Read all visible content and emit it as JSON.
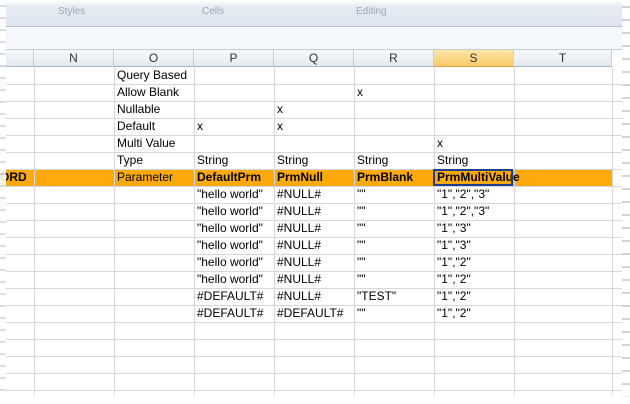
{
  "ribbon": {
    "group1": "Styles",
    "group2": "Cells",
    "group3": "Editing"
  },
  "columns": [
    "N",
    "O",
    "P",
    "Q",
    "R",
    "S",
    "T"
  ],
  "selected_column": "S",
  "rows": [
    [
      "",
      "Query Based",
      "",
      "",
      "",
      "",
      ""
    ],
    [
      "",
      "Allow Blank",
      "",
      "",
      "x",
      "",
      ""
    ],
    [
      "",
      "Nullable",
      "",
      "x",
      "",
      "",
      ""
    ],
    [
      "",
      "Default",
      "x",
      "x",
      "",
      "",
      ""
    ],
    [
      "",
      "Multi Value",
      "",
      "",
      "",
      "x",
      ""
    ],
    [
      "",
      "Type",
      "String",
      "String",
      "String",
      "String",
      ""
    ],
    [
      "",
      "Parameter",
      "DefaultPrm",
      "PrmNull",
      "PrmBlank",
      "PrmMultiValue",
      ""
    ],
    [
      "",
      "",
      "\"hello world\"",
      "#NULL#",
      "\"\"",
      "\"1\",\"2\",\"3\"",
      ""
    ],
    [
      "",
      "",
      "\"hello world\"",
      "#NULL#",
      "\"\"",
      "\"1\",\"2\",\"3\"",
      ""
    ],
    [
      "",
      "",
      "\"hello world\"",
      "#NULL#",
      "\"\"",
      "\"1\",\"3\"",
      ""
    ],
    [
      "",
      "",
      "\"hello world\"",
      "#NULL#",
      "\"\"",
      "\"1\",\"3\"",
      ""
    ],
    [
      "",
      "",
      "\"hello world\"",
      "#NULL#",
      "\"\"",
      "\"1\",\"2\"",
      ""
    ],
    [
      "",
      "",
      "\"hello world\"",
      "#NULL#",
      "\"\"",
      "\"1\",\"2\"",
      ""
    ],
    [
      "",
      "",
      "#DEFAULT#",
      "#NULL#",
      "\"TEST\"",
      "\"1\",\"2\"",
      ""
    ],
    [
      "",
      "",
      "#DEFAULT#",
      "#DEFAULT#",
      "\"\"",
      "\"1\",\"2\"",
      ""
    ]
  ],
  "left_edge_text": "ORD",
  "header_row_fill": "#ffa90a",
  "selection_border": "#1f3d8a"
}
